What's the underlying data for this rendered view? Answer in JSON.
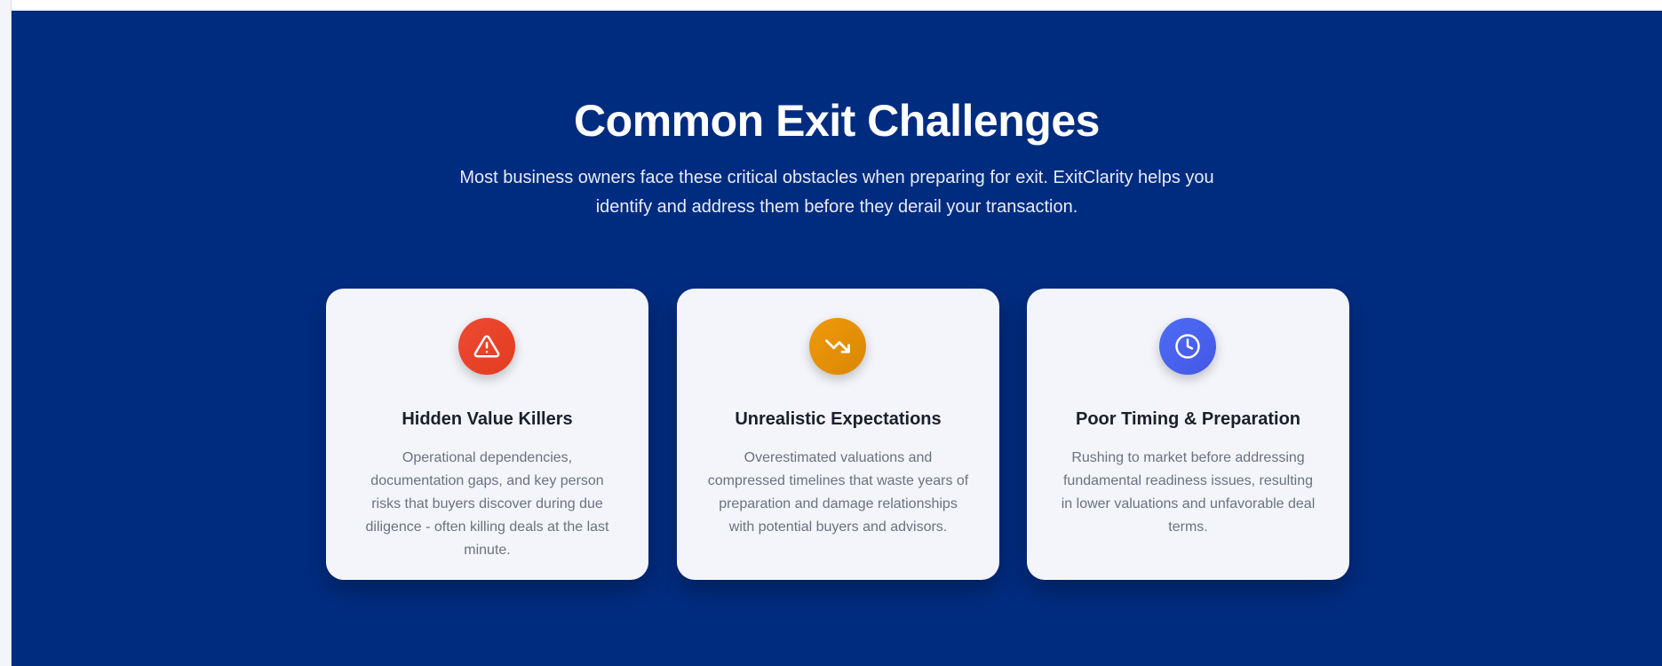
{
  "section": {
    "title": "Common Exit Challenges",
    "subtitle": "Most business owners face these critical obstacles when preparing for exit. ExitClarity helps you identify and address them before they derail your transaction.",
    "background_color": "#002c80"
  },
  "cards": [
    {
      "icon": "warning-triangle-icon",
      "icon_color": "#e8432a",
      "title": "Hidden Value Killers",
      "description": "Operational dependencies, documentation gaps, and key person risks that buyers discover during due diligence - often killing deals at the last minute."
    },
    {
      "icon": "trending-down-icon",
      "icon_color": "#e69207",
      "title": "Unrealistic Expectations",
      "description": "Overestimated valuations and compressed timelines that waste years of preparation and damage relationships with potential buyers and advisors."
    },
    {
      "icon": "clock-icon",
      "icon_color": "#4a62ee",
      "title": "Poor Timing & Preparation",
      "description": "Rushing to market before addressing fundamental readiness issues, resulting in lower valuations and unfavorable deal terms."
    }
  ]
}
